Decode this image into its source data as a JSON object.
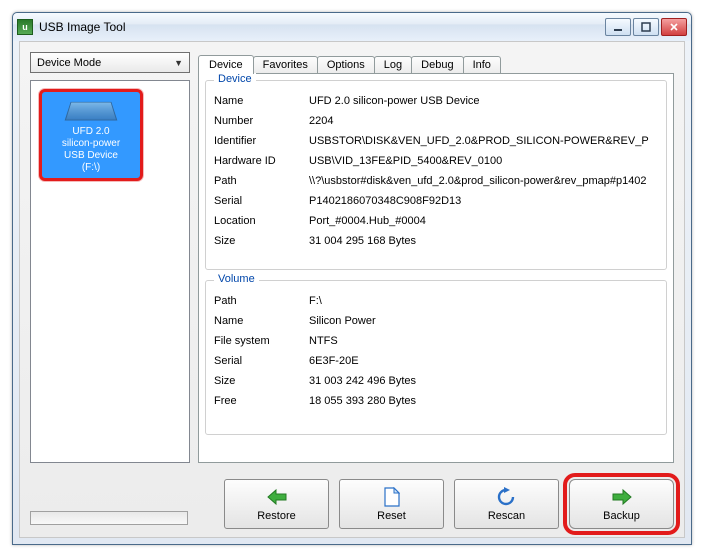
{
  "window": {
    "title": "USB Image Tool"
  },
  "mode": {
    "label": "Device Mode"
  },
  "tabs": [
    "Device",
    "Favorites",
    "Options",
    "Log",
    "Debug",
    "Info"
  ],
  "device_item": {
    "line1": "UFD 2.0",
    "line2": "silicon-power",
    "line3": "USB Device",
    "line4": "(F:\\)"
  },
  "groups": {
    "device_title": "Device",
    "volume_title": "Volume"
  },
  "device": {
    "name_label": "Name",
    "name_value": "UFD 2.0 silicon-power USB Device",
    "number_label": "Number",
    "number_value": "2204",
    "identifier_label": "Identifier",
    "identifier_value": "USBSTOR\\DISK&VEN_UFD_2.0&PROD_SILICON-POWER&REV_P",
    "hardware_label": "Hardware ID",
    "hardware_value": "USB\\VID_13FE&PID_5400&REV_0100",
    "path_label": "Path",
    "path_value": "\\\\?\\usbstor#disk&ven_ufd_2.0&prod_silicon-power&rev_pmap#p1402",
    "serial_label": "Serial",
    "serial_value": "P1402186070348C908F92D13",
    "location_label": "Location",
    "location_value": "Port_#0004.Hub_#0004",
    "size_label": "Size",
    "size_value": "31 004 295 168 Bytes"
  },
  "volume": {
    "path_label": "Path",
    "path_value": "F:\\",
    "name_label": "Name",
    "name_value": "Silicon Power",
    "fs_label": "File system",
    "fs_value": "NTFS",
    "serial_label": "Serial",
    "serial_value": "6E3F-20E",
    "size_label": "Size",
    "size_value": "31 003 242 496 Bytes",
    "free_label": "Free",
    "free_value": "18 055 393 280 Bytes"
  },
  "buttons": {
    "restore": "Restore",
    "reset": "Reset",
    "rescan": "Rescan",
    "backup": "Backup"
  }
}
